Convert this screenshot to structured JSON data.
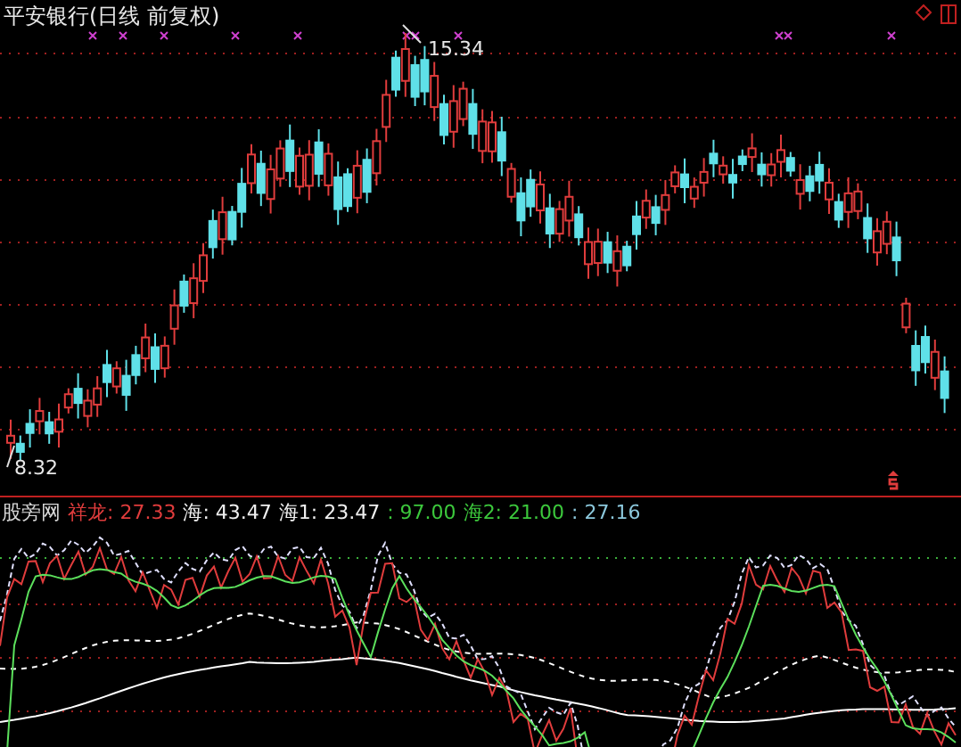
{
  "chart_title": "平安银行(日线 前复权)",
  "price_marks": [
    {
      "kind": "high",
      "label": "15.34"
    },
    {
      "kind": "low",
      "label": "8.32"
    }
  ],
  "indicator": {
    "name": "股旁网",
    "legend": [
      {
        "label": "祥龙: 27.33",
        "color": "#e03c3c"
      },
      {
        "label": "海: 43.47",
        "color": "#f0f0f0"
      },
      {
        "label": "海1: 23.47",
        "color": "#f0f0f0"
      },
      {
        "label": ": 97.00",
        "color": "#3cc83c"
      },
      {
        "label": "海2: 21.00",
        "color": "#3cc83c"
      },
      {
        "label": ": 27.16",
        "color": "#8cc8dc"
      }
    ]
  }
}
